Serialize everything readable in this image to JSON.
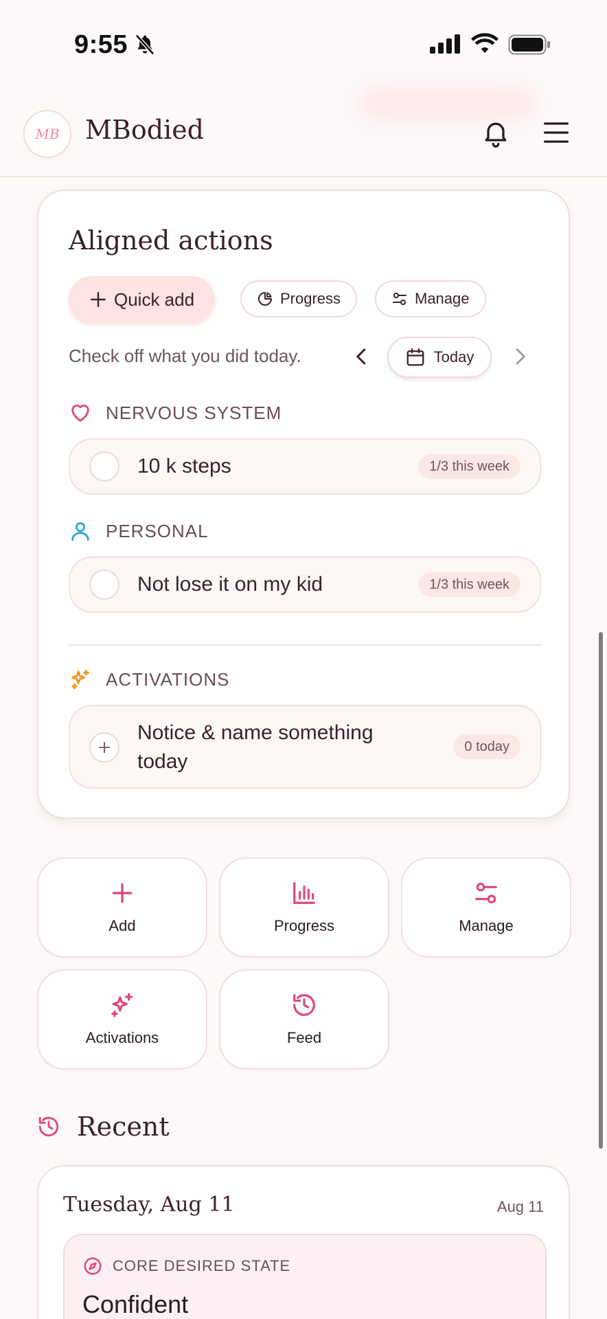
{
  "status_bar": {
    "time": "9:55"
  },
  "header": {
    "brand": "MBodied"
  },
  "aligned_actions": {
    "title": "Aligned actions",
    "quick_add_label": "Quick add",
    "progress_label": "Progress",
    "manage_label": "Manage",
    "subtitle": "Check off what you did today.",
    "date_label": "Today",
    "sections": [
      {
        "name": "NERVOUS SYSTEM",
        "icon": "heart-icon",
        "color": "#e0457b",
        "items": [
          {
            "label": "10 k steps",
            "badge": "1/3 this week"
          }
        ]
      },
      {
        "name": "PERSONAL",
        "icon": "person-icon",
        "color": "#2aa8d8",
        "items": [
          {
            "label": "Not lose it on my kid",
            "badge": "1/3 this week"
          }
        ]
      },
      {
        "name": "ACTIVATIONS",
        "icon": "sparkles-icon",
        "color": "#f0941a",
        "items": [
          {
            "label": "Notice & name something today",
            "badge": "0 today"
          }
        ]
      }
    ]
  },
  "tiles": [
    {
      "label": "Add",
      "icon": "plus-icon"
    },
    {
      "label": "Progress",
      "icon": "bar-chart-icon"
    },
    {
      "label": "Manage",
      "icon": "sliders-icon"
    },
    {
      "label": "Activations",
      "icon": "sparkles-icon"
    },
    {
      "label": "Feed",
      "icon": "history-icon"
    }
  ],
  "recent": {
    "title": "Recent",
    "day": "Tuesday, Aug 11",
    "day_short": "Aug 11",
    "entry_kind": "CORE DESIRED STATE",
    "entry_value": "Confident"
  },
  "colors": {
    "accent": "#e0457b",
    "card_border": "#f2dcdf",
    "background": "#fcf9f8"
  }
}
